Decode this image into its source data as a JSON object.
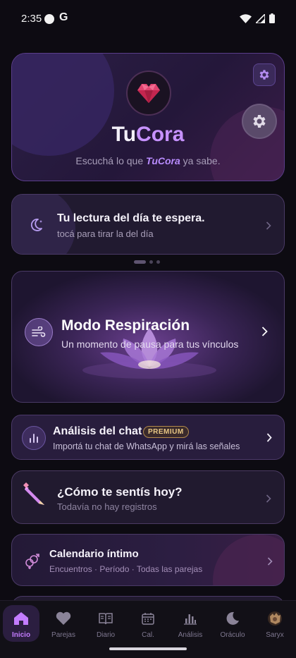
{
  "status_bar": {
    "time": "2:35",
    "notification_letter": "G"
  },
  "hero": {
    "title_part1": "Tu",
    "title_part2": "Cora",
    "subtitle_prefix": "Escuchá lo que ",
    "subtitle_brand": "TuCora",
    "subtitle_suffix": " ya sabe."
  },
  "reading": {
    "title": "Tu lectura del día te espera.",
    "subtitle": "tocá para tirar la del día"
  },
  "pager": {
    "pages": 3,
    "active": 1
  },
  "breathing": {
    "title": "Modo Respiración",
    "subtitle": "Un momento de pausa para tus vínculos"
  },
  "chat_analysis": {
    "title": "Análisis del chat",
    "badge": "PREMIUM",
    "subtitle": "Importá tu chat de WhatsApp y mirá las señales"
  },
  "mood": {
    "title": "¿Cómo te sentís hoy?",
    "subtitle": "Todavía no hay registros"
  },
  "calendar": {
    "title": "Calendario íntimo",
    "subtitle": "Encuentros · Período · Todas las parejas"
  },
  "bottom_nav": {
    "items": [
      {
        "label": "Inicio",
        "icon": "home-icon",
        "active": true
      },
      {
        "label": "Parejas",
        "icon": "heart-icon"
      },
      {
        "label": "Diario",
        "icon": "book-icon"
      },
      {
        "label": "Cal.",
        "icon": "calendar-icon"
      },
      {
        "label": "Análisis",
        "icon": "bar-chart-icon"
      },
      {
        "label": "Oráculo",
        "icon": "moon-icon"
      },
      {
        "label": "Saryx",
        "icon": "avatar-icon"
      }
    ]
  },
  "colors": {
    "accent": "#c37cff",
    "brand": "#c792ff",
    "background": "#0d0b12",
    "premium": "#e8c785"
  }
}
